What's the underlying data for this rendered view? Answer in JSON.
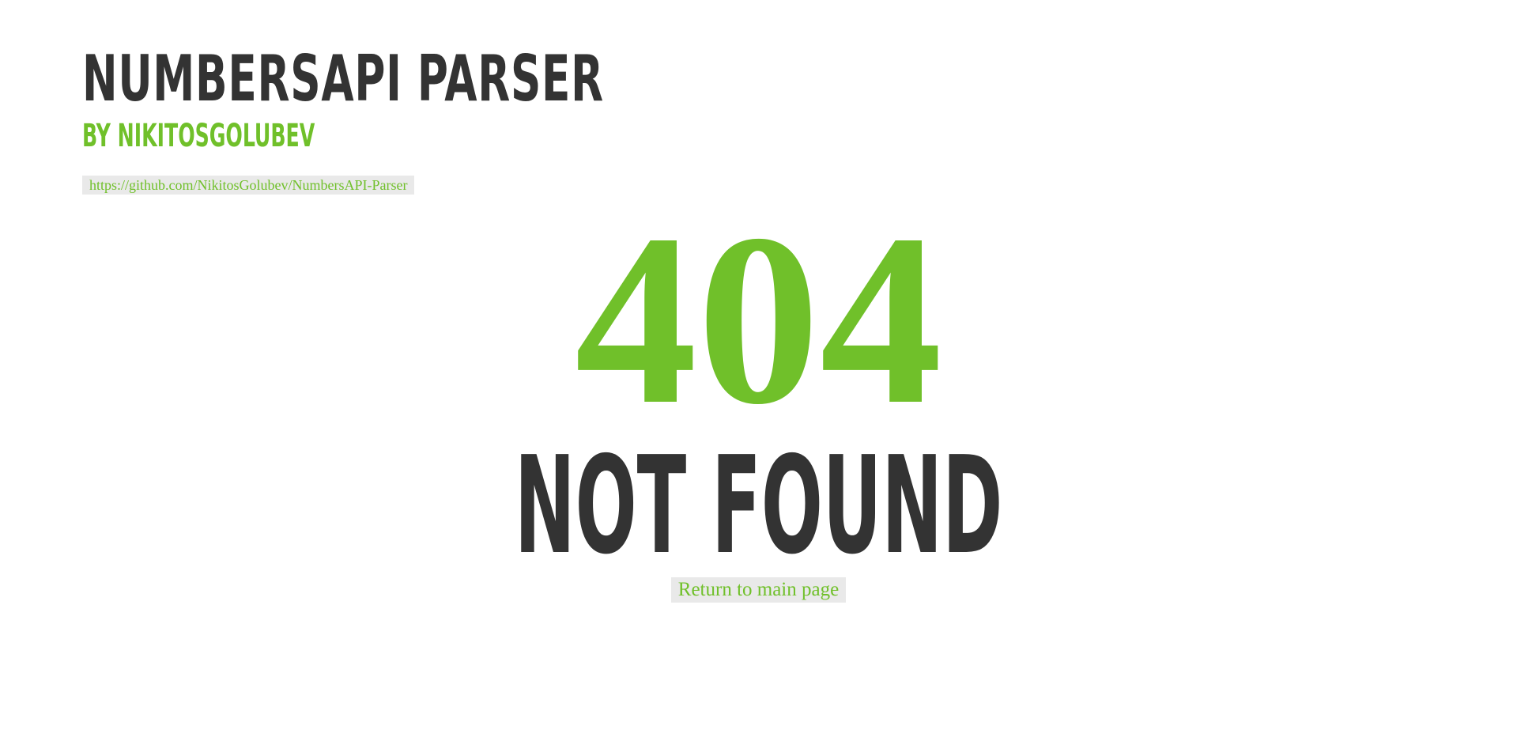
{
  "header": {
    "title": "NumbersAPI Parser",
    "subtitle": "BY NIKITOSGOLUBEV",
    "repo_link": "https://github.com/NikitosGolubev/NumbersAPI-Parser"
  },
  "error": {
    "code": "404",
    "message": "NOT FOUND",
    "return_link": "Return to main page"
  },
  "colors": {
    "accent": "#70c02a",
    "text_dark": "#333333",
    "link_background": "#e9e9e9",
    "page_background": "#ffffff"
  }
}
